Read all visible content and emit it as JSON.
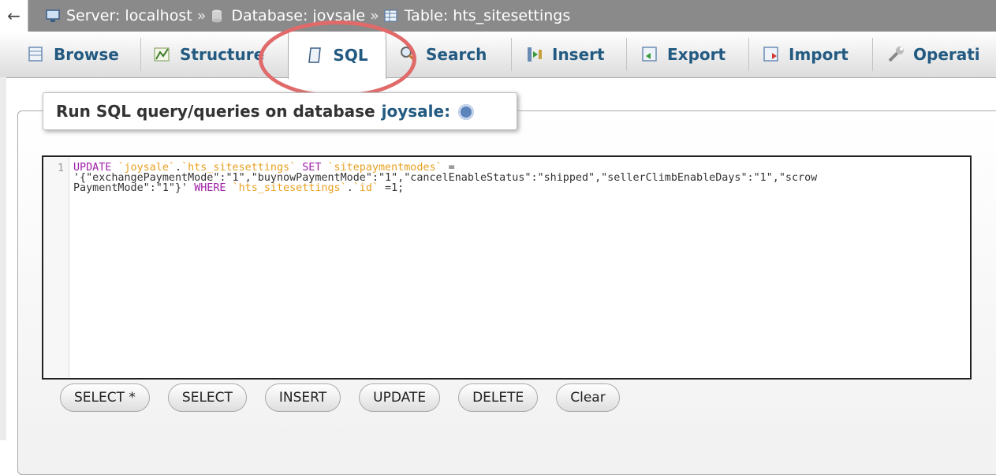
{
  "breadcrumb": {
    "back_label": "←",
    "server": "Server: localhost",
    "database": "Database: joysale",
    "table": "Table: hts_sitesettings",
    "separator": "»"
  },
  "tabs": [
    {
      "label": "Browse",
      "icon": "browse-icon"
    },
    {
      "label": "Structure",
      "icon": "structure-icon"
    },
    {
      "label": "SQL",
      "icon": "sql-icon",
      "active": true
    },
    {
      "label": "Search",
      "icon": "search-icon"
    },
    {
      "label": "Insert",
      "icon": "insert-icon"
    },
    {
      "label": "Export",
      "icon": "export-icon"
    },
    {
      "label": "Import",
      "icon": "import-icon"
    },
    {
      "label": "Operati",
      "icon": "wrench-icon"
    }
  ],
  "panel": {
    "legend_prefix": "Run SQL query/queries on database",
    "database_name": "joysale:"
  },
  "editor": {
    "line_number": "1",
    "lines": [
      "UPDATE `joysale`.`hts_sitesettings` SET `sitepaymentmodes` =",
      "'{\"exchangePaymentMode\":\"1\",\"buynowPaymentMode\":\"1\",\"cancelEnableStatus\":\"shipped\",\"sellerClimbEnableDays\":\"1\",\"scrow",
      "PaymentMode\":\"1\"}' WHERE `hts_sitesettings`.`id` =1;"
    ]
  },
  "buttons": [
    "SELECT *",
    "SELECT",
    "INSERT",
    "UPDATE",
    "DELETE",
    "Clear"
  ],
  "colors": {
    "accent": "#235a81",
    "highlight": "#e06a6a",
    "keyword": "#a020a8",
    "identifier": "#e8a020"
  }
}
